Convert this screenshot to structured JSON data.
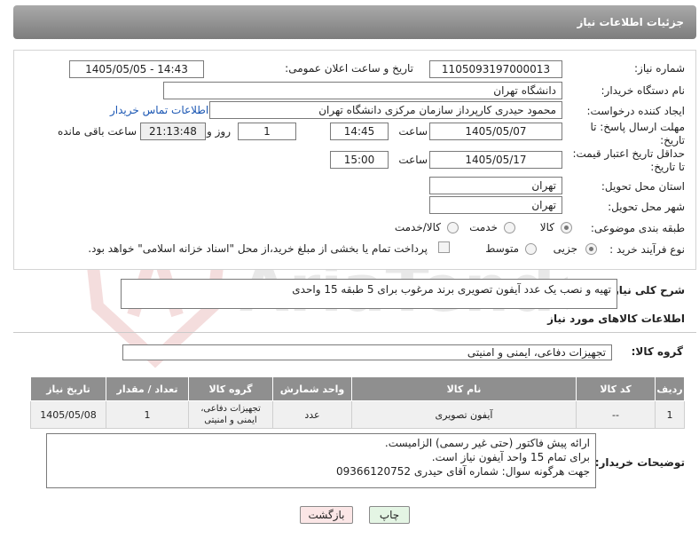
{
  "header": {
    "title": "جزئیات اطلاعات نیاز"
  },
  "fields": {
    "need_number_label": "شماره نیاز:",
    "need_number": "1105093197000013",
    "announce_label": "تاریخ و ساعت اعلان عمومی:",
    "announce_value": "1405/05/05 - 14:43",
    "buyer_org_label": "نام دستگاه خریدار:",
    "buyer_org": "دانشگاه تهران",
    "creator_label": "ایجاد کننده درخواست:",
    "creator": "محمود حیدری کارپرداز سازمان مرکزی دانشگاه تهران",
    "contact_link": "اطلاعات تماس خریدار",
    "reply_deadline_label": "مهلت ارسال پاسخ: تا تاریخ:",
    "reply_date": "1405/05/07",
    "time_label": "ساعت",
    "reply_time": "14:45",
    "days_value": "1",
    "days_label": "روز و",
    "remaining_time": "21:13:48",
    "remaining_label": "ساعت باقی مانده",
    "price_validity_label": "حداقل تاریخ اعتبار قیمت: تا تاریخ:",
    "price_date": "1405/05/17",
    "price_time": "15:00",
    "province_label": "استان محل تحویل:",
    "province": "تهران",
    "city_label": "شهر محل تحویل:",
    "city": "تهران",
    "category_label": "طبقه بندی موضوعی:",
    "cat_goods": "کالا",
    "cat_service": "خدمت",
    "cat_goods_service": "کالا/خدمت",
    "process_label": "نوع فرآیند خرید :",
    "proc_partial": "جزیی",
    "proc_medium": "متوسط",
    "payment_note": "پرداخت تمام یا بخشی از مبلغ خرید،از محل \"اسناد خزانه اسلامی\" خواهد بود."
  },
  "summary": {
    "label": "شرح کلی نیاز:",
    "text": "تهیه و نصب یک عدد آیفون تصویری برند مرغوب برای 5 طبقه 15 واحدی"
  },
  "goods_section": {
    "title": "اطلاعات کالاهای مورد نیاز",
    "group_label": "گروه کالا:",
    "group_value": "تجهیزات دفاعی، ایمنی و امنیتی"
  },
  "table": {
    "headers": [
      "ردیف",
      "کد کالا",
      "نام کالا",
      "واحد شمارش",
      "گروه کالا",
      "تعداد / مقدار",
      "تاریخ نیاز"
    ],
    "rows": [
      [
        "1",
        "--",
        "آیفون تصویری",
        "عدد",
        "تجهیزات دفاعی، ایمنی و امنیتی",
        "1",
        "1405/05/08"
      ]
    ]
  },
  "buyer_notes": {
    "label": "توضیحات خریدار:",
    "line1": "ارائه پیش فاکتور (حتی غیر رسمی)  الزامیست.",
    "line2": "برای تمام 15 واحد آیفون نیاز است.",
    "line3": "جهت هرگونه سوال: شماره آقای حیدری 09366120752"
  },
  "buttons": {
    "print": "چاپ",
    "back": "بازگشت"
  },
  "watermark_text": "AriaTender.net",
  "colors": {
    "header": "#8f8f8f",
    "link": "#1a56b3",
    "print_bg": "#e4f5e4",
    "back_bg": "#fbe6e6"
  }
}
